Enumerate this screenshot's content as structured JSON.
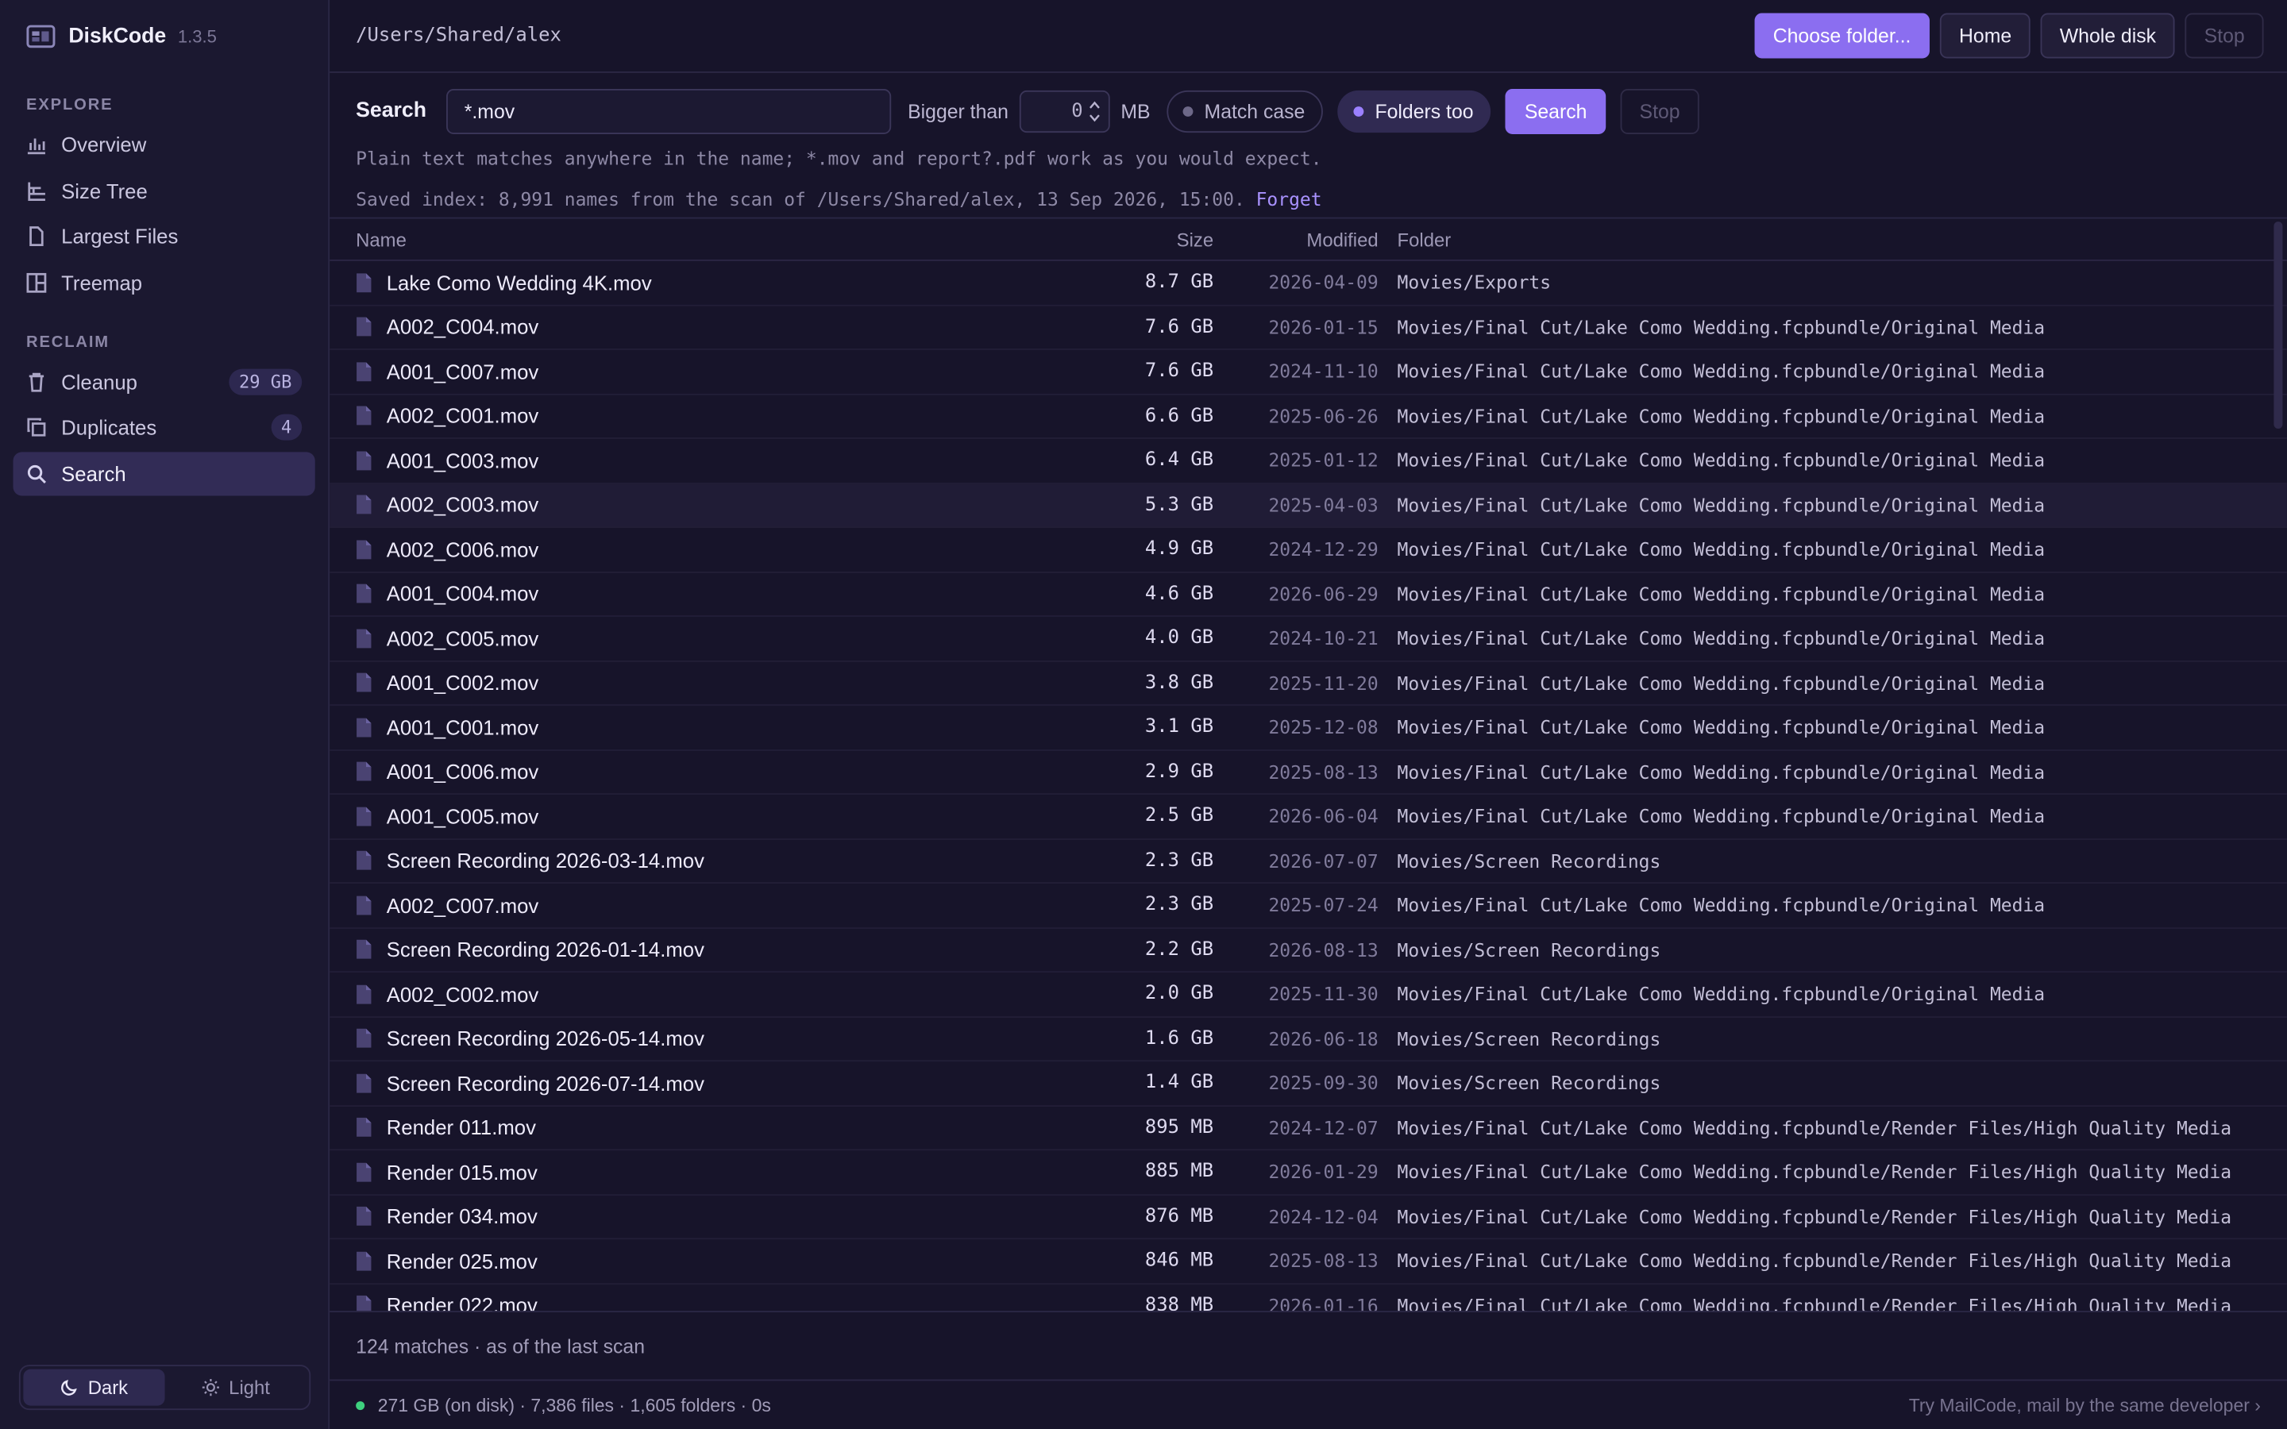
{
  "app": {
    "name": "DiskCode",
    "version": "1.3.5"
  },
  "sidebar": {
    "sections": [
      {
        "title": "EXPLORE",
        "items": [
          {
            "label": "Overview",
            "icon": "bar-chart-icon"
          },
          {
            "label": "Size Tree",
            "icon": "tree-icon"
          },
          {
            "label": "Largest Files",
            "icon": "file-icon"
          },
          {
            "label": "Treemap",
            "icon": "treemap-icon"
          }
        ]
      },
      {
        "title": "RECLAIM",
        "items": [
          {
            "label": "Cleanup",
            "icon": "trash-icon",
            "badge": "29 GB"
          },
          {
            "label": "Duplicates",
            "icon": "copy-icon",
            "badge": "4"
          },
          {
            "label": "Search",
            "icon": "search-icon",
            "active": true
          }
        ]
      }
    ],
    "theme": {
      "dark_label": "Dark",
      "light_label": "Light",
      "selected": "Dark"
    }
  },
  "topbar": {
    "path": "/Users/Shared/alex",
    "choose_folder_label": "Choose folder...",
    "home_label": "Home",
    "whole_disk_label": "Whole disk",
    "stop_label": "Stop"
  },
  "search": {
    "label": "Search",
    "query": "*.mov",
    "bigger_than_label": "Bigger than",
    "bigger_than_value": "0",
    "unit": "MB",
    "match_case_label": "Match case",
    "match_case_on": false,
    "folders_too_label": "Folders too",
    "folders_too_on": true,
    "search_button": "Search",
    "stop_button": "Stop",
    "hint": "Plain text matches anywhere in the name; *.mov and report?.pdf work as you would expect.",
    "index_text": "Saved index: 8,991 names from the scan of /Users/Shared/alex, 13 Sep 2026, 15:00.",
    "forget_label": "Forget"
  },
  "table": {
    "columns": {
      "name": "Name",
      "size": "Size",
      "modified": "Modified",
      "folder": "Folder"
    },
    "rows": [
      {
        "name": "Lake Como Wedding 4K.mov",
        "size": "8.7 GB",
        "modified": "2026-04-09",
        "folder": "Movies/Exports"
      },
      {
        "name": "A002_C004.mov",
        "size": "7.6 GB",
        "modified": "2026-01-15",
        "folder": "Movies/Final Cut/Lake Como Wedding.fcpbundle/Original Media"
      },
      {
        "name": "A001_C007.mov",
        "size": "7.6 GB",
        "modified": "2024-11-10",
        "folder": "Movies/Final Cut/Lake Como Wedding.fcpbundle/Original Media"
      },
      {
        "name": "A002_C001.mov",
        "size": "6.6 GB",
        "modified": "2025-06-26",
        "folder": "Movies/Final Cut/Lake Como Wedding.fcpbundle/Original Media"
      },
      {
        "name": "A001_C003.mov",
        "size": "6.4 GB",
        "modified": "2025-01-12",
        "folder": "Movies/Final Cut/Lake Como Wedding.fcpbundle/Original Media"
      },
      {
        "name": "A002_C003.mov",
        "size": "5.3 GB",
        "modified": "2025-04-03",
        "folder": "Movies/Final Cut/Lake Como Wedding.fcpbundle/Original Media",
        "highlighted": true
      },
      {
        "name": "A002_C006.mov",
        "size": "4.9 GB",
        "modified": "2024-12-29",
        "folder": "Movies/Final Cut/Lake Como Wedding.fcpbundle/Original Media"
      },
      {
        "name": "A001_C004.mov",
        "size": "4.6 GB",
        "modified": "2026-06-29",
        "folder": "Movies/Final Cut/Lake Como Wedding.fcpbundle/Original Media"
      },
      {
        "name": "A002_C005.mov",
        "size": "4.0 GB",
        "modified": "2024-10-21",
        "folder": "Movies/Final Cut/Lake Como Wedding.fcpbundle/Original Media"
      },
      {
        "name": "A001_C002.mov",
        "size": "3.8 GB",
        "modified": "2025-11-20",
        "folder": "Movies/Final Cut/Lake Como Wedding.fcpbundle/Original Media"
      },
      {
        "name": "A001_C001.mov",
        "size": "3.1 GB",
        "modified": "2025-12-08",
        "folder": "Movies/Final Cut/Lake Como Wedding.fcpbundle/Original Media"
      },
      {
        "name": "A001_C006.mov",
        "size": "2.9 GB",
        "modified": "2025-08-13",
        "folder": "Movies/Final Cut/Lake Como Wedding.fcpbundle/Original Media"
      },
      {
        "name": "A001_C005.mov",
        "size": "2.5 GB",
        "modified": "2026-06-04",
        "folder": "Movies/Final Cut/Lake Como Wedding.fcpbundle/Original Media"
      },
      {
        "name": "Screen Recording 2026-03-14.mov",
        "size": "2.3 GB",
        "modified": "2026-07-07",
        "folder": "Movies/Screen Recordings"
      },
      {
        "name": "A002_C007.mov",
        "size": "2.3 GB",
        "modified": "2025-07-24",
        "folder": "Movies/Final Cut/Lake Como Wedding.fcpbundle/Original Media"
      },
      {
        "name": "Screen Recording 2026-01-14.mov",
        "size": "2.2 GB",
        "modified": "2026-08-13",
        "folder": "Movies/Screen Recordings"
      },
      {
        "name": "A002_C002.mov",
        "size": "2.0 GB",
        "modified": "2025-11-30",
        "folder": "Movies/Final Cut/Lake Como Wedding.fcpbundle/Original Media"
      },
      {
        "name": "Screen Recording 2026-05-14.mov",
        "size": "1.6 GB",
        "modified": "2026-06-18",
        "folder": "Movies/Screen Recordings"
      },
      {
        "name": "Screen Recording 2026-07-14.mov",
        "size": "1.4 GB",
        "modified": "2025-09-30",
        "folder": "Movies/Screen Recordings"
      },
      {
        "name": "Render 011.mov",
        "size": "895 MB",
        "modified": "2024-12-07",
        "folder": "Movies/Final Cut/Lake Como Wedding.fcpbundle/Render Files/High Quality Media"
      },
      {
        "name": "Render 015.mov",
        "size": "885 MB",
        "modified": "2026-01-29",
        "folder": "Movies/Final Cut/Lake Como Wedding.fcpbundle/Render Files/High Quality Media"
      },
      {
        "name": "Render 034.mov",
        "size": "876 MB",
        "modified": "2024-12-04",
        "folder": "Movies/Final Cut/Lake Como Wedding.fcpbundle/Render Files/High Quality Media"
      },
      {
        "name": "Render 025.mov",
        "size": "846 MB",
        "modified": "2025-08-13",
        "folder": "Movies/Final Cut/Lake Como Wedding.fcpbundle/Render Files/High Quality Media"
      },
      {
        "name": "Render 022.mov",
        "size": "838 MB",
        "modified": "2026-01-16",
        "folder": "Movies/Final Cut/Lake Como Wedding.fcpbundle/Render Files/High Quality Media"
      }
    ]
  },
  "footer": {
    "matches": "124 matches · as of the last scan",
    "status": "271 GB (on disk) · 7,386 files · 1,605 folders · 0s",
    "promo": "Try MailCode, mail by the same developer ›"
  },
  "colors": {
    "accent": "#8b6ef0",
    "status_ok": "#3ed07e",
    "background": "#17142a"
  }
}
